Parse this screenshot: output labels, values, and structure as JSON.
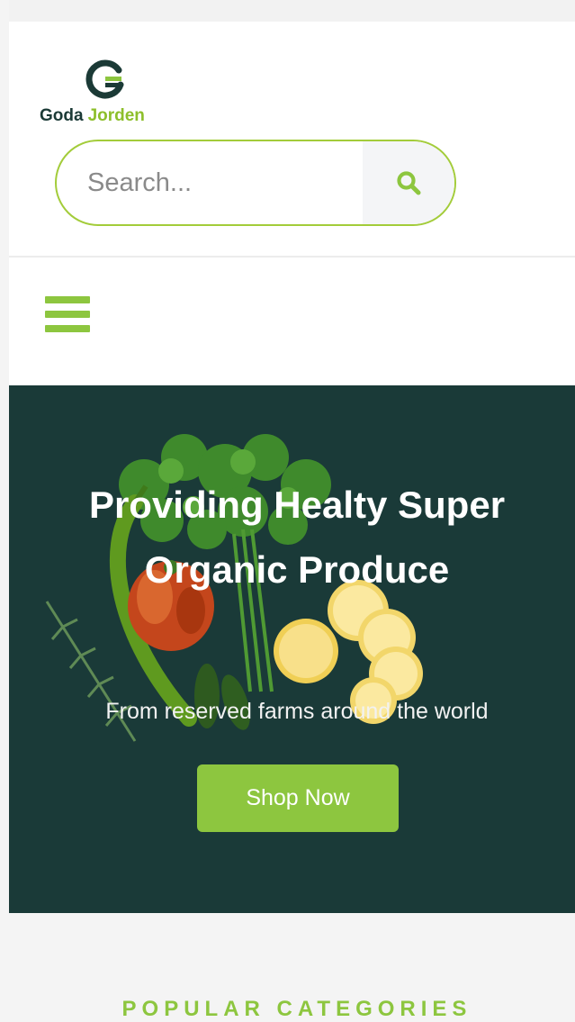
{
  "brand": {
    "word1": "Goda",
    "word2": "Jorden"
  },
  "search": {
    "placeholder": "Search..."
  },
  "hero": {
    "title": "Providing Healty Super Organic Produce",
    "subtitle": "From reserved farms around the world",
    "button_label": "Shop Now"
  },
  "categories": {
    "heading": "POPULAR CATEGORIES"
  },
  "icons": {
    "logo": "goda-jorden-g-logo-icon",
    "search": "search-icon",
    "menu": "hamburger-menu-icon"
  },
  "colors": {
    "accent_green": "#8dc63f",
    "dark_green": "#1a3a38",
    "logo_dark": "#1b3a36"
  }
}
